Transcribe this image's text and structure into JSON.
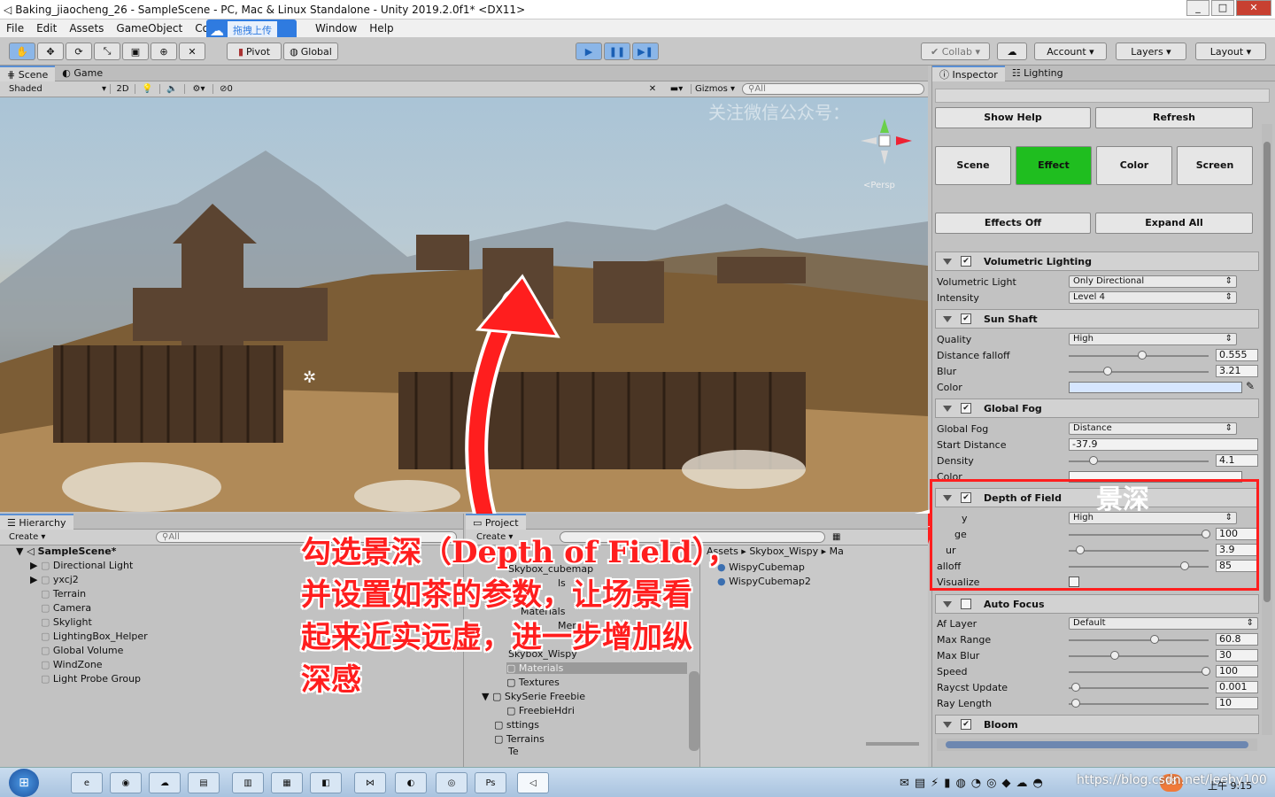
{
  "window": {
    "title": "Baking_jiaocheng_26 - SampleScene - PC, Mac & Linux Standalone - Unity 2019.2.0f1* <DX11>",
    "controls": [
      "_",
      "□",
      "✕"
    ]
  },
  "menu": [
    "File",
    "Edit",
    "Assets",
    "GameObject",
    "Co",
    "Window",
    "Help"
  ],
  "overlay_upload": "拖拽上传",
  "toolbar": {
    "pivot": "Pivot",
    "global": "Global",
    "collab": "Collab",
    "account": "Account",
    "layers": "Layers",
    "layout": "Layout"
  },
  "scene": {
    "tabs": [
      "Scene",
      "Game"
    ],
    "shading": "Shaded",
    "mode2d": "2D",
    "fx_count": "0",
    "gizmos": "Gizmos",
    "search": "All",
    "persp": "Persp",
    "watermark": "关注微信公众号：",
    "annotation_dof": "景深"
  },
  "inspector": {
    "tabs": [
      "Inspector",
      "Lighting"
    ],
    "show_help": "Show Help",
    "refresh": "Refresh",
    "mode_tabs": [
      "Scene",
      "Effect",
      "Color",
      "Screen"
    ],
    "effects_off": "Effects Off",
    "expand_all": "Expand All",
    "vol_lighting": {
      "header": "Volumetric Lighting",
      "rows": [
        {
          "label": "Volumetric Light",
          "value": "Only Directional"
        },
        {
          "label": "Intensity",
          "value": "Level 4"
        }
      ]
    },
    "sun_shaft": {
      "header": "Sun Shaft",
      "quality_label": "Quality",
      "quality": "High",
      "falloff_label": "Distance falloff",
      "falloff": "0.555",
      "falloff_frac": 0.52,
      "blur_label": "Blur",
      "blur": "3.21",
      "blur_frac": 0.26,
      "color_label": "Color"
    },
    "global_fog": {
      "header": "Global Fog",
      "fog_label": "Global Fog",
      "fog": "Distance",
      "start_label": "Start Distance",
      "start": "-37.9",
      "density_label": "Density",
      "density": "4.1",
      "density_frac": 0.15,
      "color_label": "Color"
    },
    "dof": {
      "header": "Depth of Field",
      "q_label": "y",
      "q": "High",
      "r1_label": "ge",
      "r1": "100",
      "r1_frac": 1.0,
      "r2_label": "ur",
      "r2": "3.9",
      "r2_frac": 0.05,
      "r3_label": "alloff",
      "r3": "85",
      "r3_frac": 0.84,
      "vis_label": "Visualize"
    },
    "auto_focus": {
      "header": "Auto Focus",
      "af_label": "Af Layer",
      "af": "Default",
      "rows": [
        {
          "label": "Max Range",
          "value": "60.8",
          "frac": 0.61
        },
        {
          "label": "Max Blur",
          "value": "30",
          "frac": 0.31
        },
        {
          "label": "Speed",
          "value": "100",
          "frac": 1.0
        },
        {
          "label": "Raycst Update",
          "value": "0.001",
          "frac": 0.02
        },
        {
          "label": "Ray Length",
          "value": "10",
          "frac": 0.02
        }
      ]
    },
    "bloom": {
      "header": "Bloom"
    }
  },
  "hierarchy": {
    "tab": "Hierarchy",
    "create": "Create",
    "search": "All",
    "scene": "SampleScene*",
    "items": [
      "Directional Light",
      "yxcj2",
      "Terrain",
      "Camera",
      "Skylight",
      "LightingBox_Helper",
      "Global Volume",
      "WindZone",
      "Light Probe Group"
    ]
  },
  "project": {
    "tab": "Project",
    "create": "Create",
    "breadcrumb": [
      "Assets",
      "Skybox_Wispy",
      "Ma"
    ],
    "tree": [
      "Skybox_cubemap",
      "ls",
      "Materials",
      "Menaci",
      "Skybox_Wispy",
      "Materials",
      "Textures",
      "SkySerie Freebie",
      "FreebieHdri",
      "sttings",
      "Terrains",
      "Te"
    ],
    "assets": [
      "WispyCubemap",
      "WispyCubemap2"
    ]
  },
  "annotation": "勾选景深（Depth of Field），\n并设置如茶的参数，让场景看\n起来近实远虚，进一步增加纵\n深感",
  "taskbar": {
    "url": "https://blog.csdn.net/leeby100",
    "time": "上午 9:15",
    "badge": "85"
  }
}
